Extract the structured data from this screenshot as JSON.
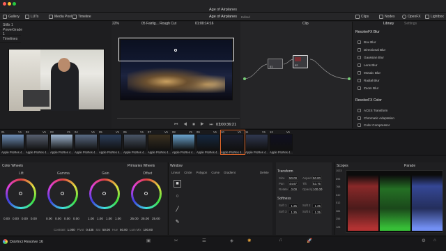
{
  "window": {
    "title": "Age of Airplanes"
  },
  "toolbar": {
    "gallery": "Gallery",
    "luts": "LUTs",
    "media_pool": "Media Pool",
    "timeline": "Timeline",
    "project": "Age of Airplanes",
    "status": "Edited",
    "clips": "Clips",
    "nodes": "Nodes",
    "openfx": "OpenFX",
    "lightbox": "Lightbox"
  },
  "viewer": {
    "zoom": "22%",
    "name": "05 Fairlig... Rough Cut",
    "timecode": "01:00:14:16",
    "timecode_playhead": "01:00:36:21",
    "node_label": "Clip"
  },
  "gallery": {
    "items": [
      "Stills 1",
      "PowerGrade 1",
      "Timelines"
    ]
  },
  "openfx": {
    "tab_library": "Library",
    "tab_settings": "Settings",
    "group1": "ResolveFX Blur",
    "blur": [
      "Box Blur",
      "Directional Blur",
      "Gaussian Blur",
      "Lens Blur",
      "Mosaic Blur",
      "Radial Blur",
      "Zoom Blur"
    ],
    "group2": "ResolveFX Color",
    "color": [
      "ACES Transform",
      "Chromatic Adaptation",
      "Color Compressor"
    ]
  },
  "nodes": {
    "n1": "01",
    "n2": "02"
  },
  "clips": [
    {
      "num": "01",
      "track": "V1",
      "label": "Apple ProRes 4..."
    },
    {
      "num": "02",
      "track": "V1",
      "label": "Apple ProRes 4..."
    },
    {
      "num": "03",
      "track": "V1",
      "label": "Apple ProRes 4..."
    },
    {
      "num": "04",
      "track": "V1",
      "label": "Apple ProRes 4..."
    },
    {
      "num": "05",
      "track": "V1",
      "label": "Apple ProRes 4..."
    },
    {
      "num": "06",
      "track": "V1",
      "label": "Apple ProRes 4..."
    },
    {
      "num": "07",
      "track": "V1",
      "label": "Apple ProRes 4..."
    },
    {
      "num": "08",
      "track": "V1",
      "label": "Apple ProRes 4..."
    },
    {
      "num": "09",
      "track": "V1",
      "label": "Apple ProRes 4..."
    },
    {
      "num": "10",
      "track": "V1",
      "label": "Apple ProRes 4..."
    },
    {
      "num": "11",
      "track": "V1",
      "label": "Apple ProRes 4..."
    },
    {
      "num": "12",
      "track": "V1",
      "label": "Apple ProRes 4..."
    }
  ],
  "wheels": {
    "title": "Color Wheels",
    "mode": "Primaries Wheels",
    "lift": "Lift",
    "gamma": "Gamma",
    "gain": "Gain",
    "offset": "Offset",
    "lift_vals": [
      "0.00",
      "0.00",
      "0.00",
      "0.00"
    ],
    "gamma_vals": [
      "0.00",
      "0.00",
      "0.00",
      "0.00"
    ],
    "gain_vals": [
      "1.00",
      "1.00",
      "1.00",
      "1.00"
    ],
    "offset_vals": [
      "25.00",
      "25.00",
      "25.00"
    ],
    "contrast_lbl": "Contrast",
    "contrast": "1.000",
    "pivot_lbl": "Pivot",
    "pivot": "0.435",
    "sat_lbl": "Sat",
    "sat": "50.00",
    "hue_lbl": "Hue",
    "hue": "50.00",
    "lummix_lbl": "Lum Mix",
    "lummix": "100.00"
  },
  "window_panel": {
    "title": "Window",
    "linear": "Linear",
    "circle": "Circle",
    "polygon": "Polygon",
    "curve": "Curve",
    "gradient": "Gradient",
    "delete": "Delete"
  },
  "transform": {
    "title": "Transform",
    "size_lbl": "Size",
    "size": "50.00",
    "aspect_lbl": "Aspect",
    "aspect": "50.00",
    "pan_lbl": "Pan",
    "pan": "44.67",
    "tilt_lbl": "Tilt",
    "tilt": "53.76",
    "rotate_lbl": "Rotate",
    "rotate": "0.00",
    "opacity_lbl": "Opacity",
    "opacity": "100.00",
    "softness": "Softness",
    "soft1_lbl": "Soft 1",
    "soft1": "1.25",
    "soft2_lbl": "Soft 2",
    "soft2": "1.25",
    "soft3_lbl": "Soft 3",
    "soft3": "1.25",
    "soft4_lbl": "Soft 4",
    "soft4": "1.25"
  },
  "scopes": {
    "title": "Scopes",
    "mode": "Parade",
    "ticks": [
      "1023",
      "896",
      "768",
      "640",
      "512",
      "384",
      "256",
      "128"
    ]
  },
  "app": {
    "name": "DaVinci Resolve 16"
  }
}
